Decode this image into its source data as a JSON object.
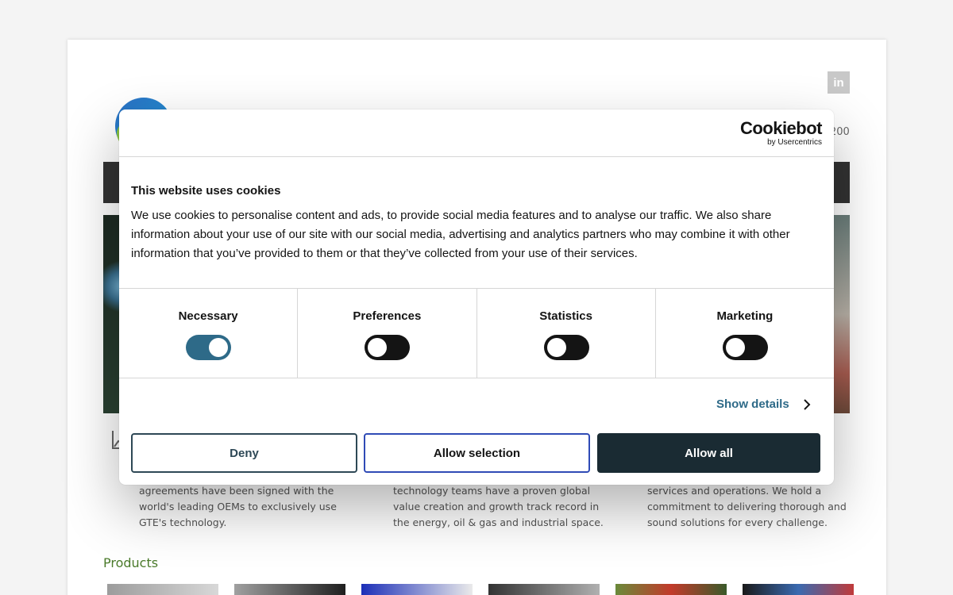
{
  "site": {
    "linkedin_label": "in",
    "phone_fragment": "200"
  },
  "features": [
    {
      "lines": [
        "agreements have been signed with the",
        "world's leading OEMs to exclusively use",
        "GTE's technology."
      ]
    },
    {
      "lines": [
        "technology teams have a proven global",
        "value creation and growth track record in",
        "the energy, oil & gas and industrial space."
      ]
    },
    {
      "lines": [
        "services and operations. We hold a",
        "commitment to delivering thorough and",
        "sound solutions for every challenge."
      ]
    }
  ],
  "products": {
    "heading": "Products"
  },
  "cookie": {
    "brand": "Cookiebot",
    "brand_sub": "by Usercentrics",
    "title": "This website uses cookies",
    "text": "We use cookies to personalise content and ads, to provide social media features and to analyse our traffic. We also share information about your use of our site with our social media, advertising and analytics partners who may combine it with other information that you’ve provided to them or that they’ve collected from your use of their services.",
    "categories": [
      {
        "label": "Necessary",
        "enabled": true
      },
      {
        "label": "Preferences",
        "enabled": false
      },
      {
        "label": "Statistics",
        "enabled": false
      },
      {
        "label": "Marketing",
        "enabled": false
      }
    ],
    "show_details": "Show details",
    "buttons": {
      "deny": "Deny",
      "allow_selection": "Allow selection",
      "allow_all": "Allow all"
    }
  },
  "colors": {
    "accent": "#2e6a88",
    "dark_button": "#1a2b33",
    "products_heading": "#4a7a2a",
    "navbar": "#333333"
  }
}
